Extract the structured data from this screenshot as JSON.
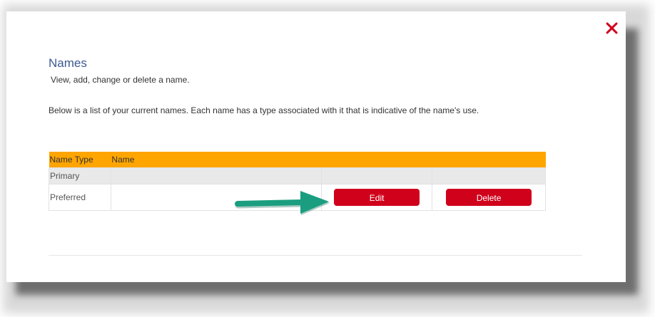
{
  "dialog": {
    "title": "Names",
    "subtitle": "View, add, change or delete a name.",
    "description": "Below is a list of your current names. Each name has a type associated with it that is indicative of the name's use."
  },
  "table": {
    "headers": [
      "Name Type",
      "Name"
    ],
    "rows": [
      {
        "type": "Primary",
        "name": ""
      },
      {
        "type": "Preferred",
        "name": "",
        "edit_label": "Edit",
        "delete_label": "Delete"
      }
    ]
  },
  "icons": {
    "close": "close-icon",
    "arrow": "arrow-right-icon"
  },
  "colors": {
    "accent_header": "#ffa500",
    "button_red": "#d0021b",
    "title_blue": "#3c5a91",
    "arrow_teal": "#1a9e7f",
    "close_red": "#d0021b"
  }
}
